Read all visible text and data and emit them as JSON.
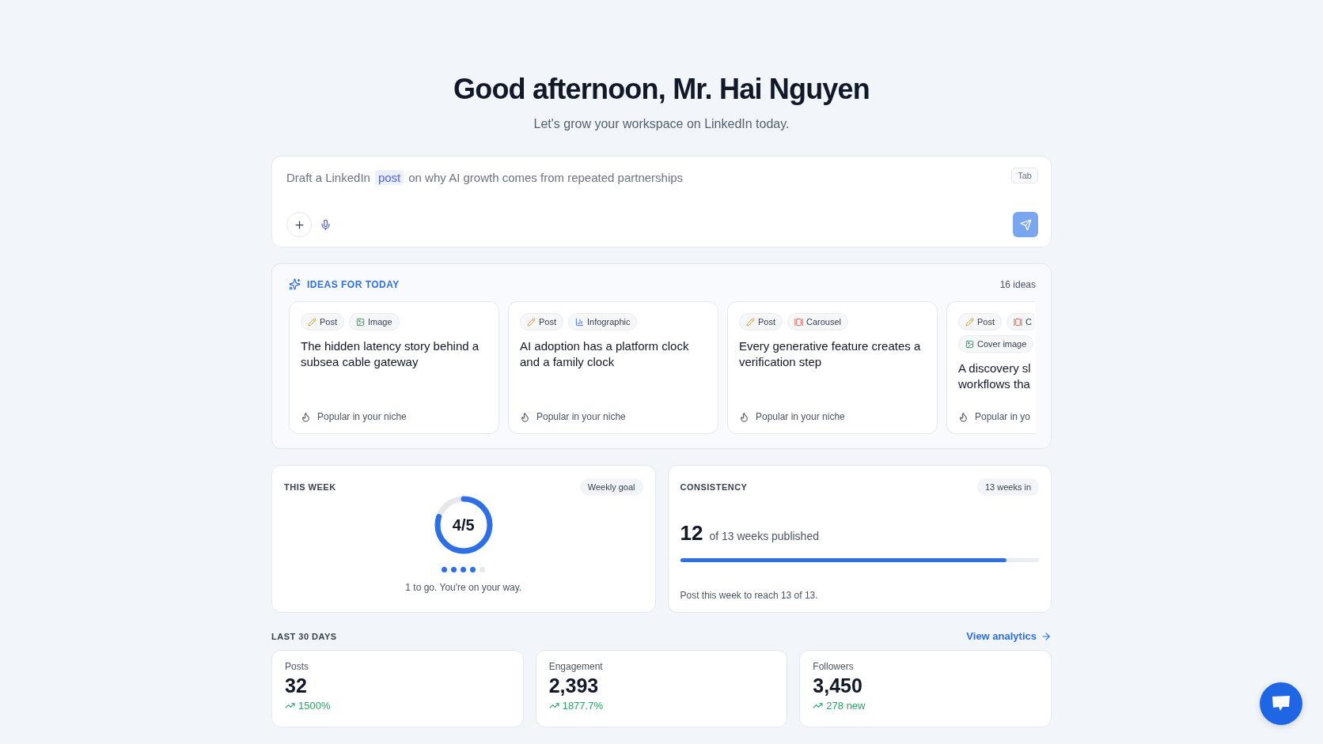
{
  "greeting": {
    "title": "Good afternoon, Mr. Hai Nguyen",
    "subtitle": "Let's grow your workspace on LinkedIn today."
  },
  "prompt": {
    "text_before": "Draft a LinkedIn",
    "chip": "post",
    "text_after": "on why AI growth comes from repeated partnerships",
    "shortcut": "Tab"
  },
  "ideas": {
    "title": "IDEAS FOR TODAY",
    "count": "16 ideas",
    "cards": [
      {
        "tags": [
          {
            "kind": "post",
            "label": "Post"
          },
          {
            "kind": "image",
            "label": "Image"
          }
        ],
        "title_lines": [
          "The hidden latency story behind a",
          "subsea cable gateway"
        ],
        "footer": "Popular in your niche"
      },
      {
        "tags": [
          {
            "kind": "post",
            "label": "Post"
          },
          {
            "kind": "chart",
            "label": "Infographic"
          }
        ],
        "title_lines": [
          "AI adoption has a platform clock",
          "and a family clock"
        ],
        "footer": "Popular in your niche"
      },
      {
        "tags": [
          {
            "kind": "post",
            "label": "Post"
          },
          {
            "kind": "carousel",
            "label": "Carousel"
          }
        ],
        "title_lines": [
          "Every generative feature creates a",
          "verification step"
        ],
        "footer": "Popular in your niche"
      },
      {
        "tags": [
          {
            "kind": "post",
            "label": "Post"
          },
          {
            "kind": "carousel",
            "label": "C"
          },
          {
            "kind": "image",
            "label": "Cover image"
          }
        ],
        "title_lines": [
          "A discovery sl",
          "workflows tha"
        ],
        "footer": "Popular in yo"
      }
    ]
  },
  "this_week": {
    "title": "THIS WEEK",
    "badge": "Weekly goal",
    "ring_label": "4/5",
    "level": 0.8,
    "dots": [
      {
        "filled": true
      },
      {
        "filled": true
      },
      {
        "filled": true
      },
      {
        "filled": true
      },
      {
        "filled": false
      }
    ],
    "note": "1 to go. You're on your way."
  },
  "consistency": {
    "title": "CONSISTENCY",
    "badge": "13 weeks in",
    "value": "12",
    "value_text": "of 13 weeks published",
    "level": 0.91,
    "note": "Post this week to reach 13 of 13."
  },
  "last_30_days": {
    "title": "LAST 30 DAYS",
    "link": "View analytics",
    "stats": [
      {
        "label": "Posts",
        "value": "32",
        "change": "1500%"
      },
      {
        "label": "Engagement",
        "value": "2,393",
        "change": "1877.7%"
      },
      {
        "label": "Followers",
        "value": "3,450",
        "change": "278 new"
      }
    ]
  }
}
